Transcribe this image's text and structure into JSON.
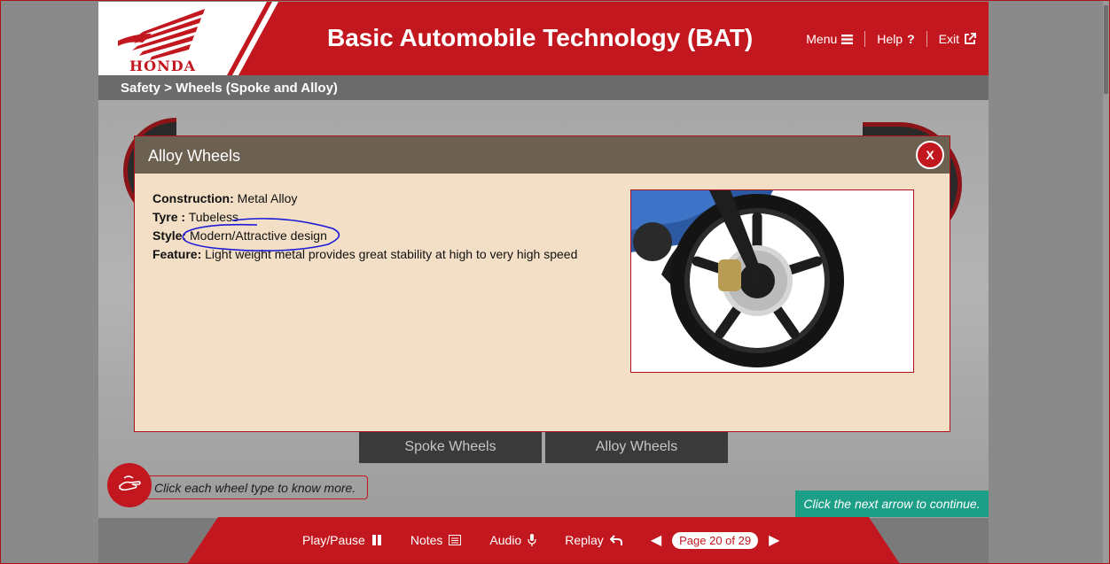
{
  "brand": {
    "logo_text": "HONDA",
    "color": "#c3171f"
  },
  "header": {
    "title": "Basic Automobile Technology (BAT)",
    "nav": [
      {
        "label": "Menu",
        "icon": "hamburger-icon"
      },
      {
        "label": "Help",
        "icon": "question-icon"
      },
      {
        "label": "Exit",
        "icon": "external-link-icon"
      }
    ]
  },
  "breadcrumb": {
    "text": "Safety > Wheels (Spoke and Alloy)"
  },
  "tabs": {
    "spoke": "Spoke Wheels",
    "alloy": "Alloy Wheels"
  },
  "hint": {
    "text": "Click each wheel type to know more.",
    "icon": "touch-hand-icon"
  },
  "continue_banner": {
    "text": "Click the next arrow to continue."
  },
  "footer": {
    "play_pause": "Play/Pause",
    "notes": "Notes",
    "audio": "Audio",
    "replay": "Replay",
    "page": "Page 20 of 29"
  },
  "modal": {
    "title": "Alloy Wheels",
    "close_label": "X",
    "specs": [
      {
        "label": "Construction:",
        "value": "Metal Alloy"
      },
      {
        "label": "Tyre :",
        "value": "Tubeless"
      },
      {
        "label": "Style:",
        "value": "Modern/Attractive design"
      },
      {
        "label": "Feature:",
        "value": "Light weight metal provides great stability at high to very high speed"
      }
    ],
    "image_icon": "alloy-wheel-image"
  }
}
